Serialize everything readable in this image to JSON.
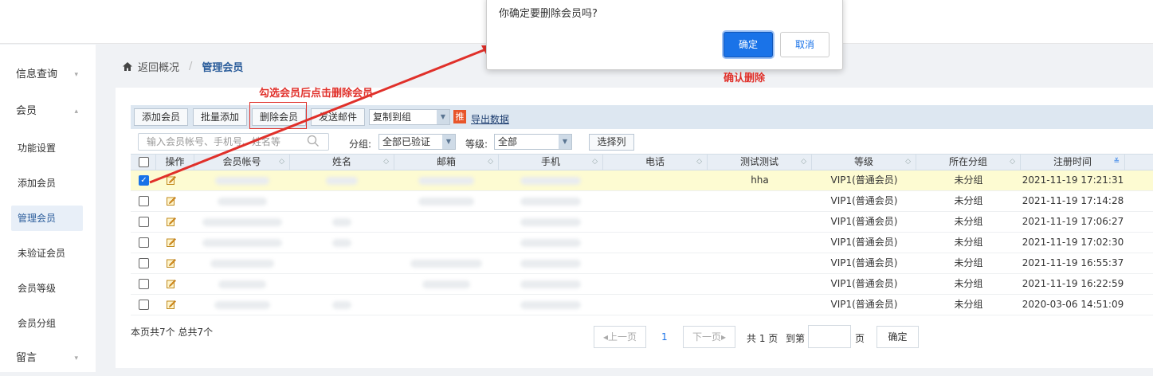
{
  "sidebar": {
    "items": [
      {
        "label": "信息查询",
        "arrow": "▾"
      },
      {
        "label": "会员",
        "arrow": "▴"
      },
      {
        "label": "功能设置"
      },
      {
        "label": "添加会员"
      },
      {
        "label": "管理会员"
      },
      {
        "label": "未验证会员"
      },
      {
        "label": "会员等级"
      },
      {
        "label": "会员分组"
      },
      {
        "label": "留言",
        "arrow": "▾"
      }
    ]
  },
  "breadcrumb": {
    "back": "返回概况",
    "sep": "/",
    "current": "管理会员"
  },
  "toolbar": {
    "add": "添加会员",
    "batch_add": "批量添加",
    "delete": "删除会员",
    "send_mail": "发送邮件",
    "copy_to_group": "复制到组",
    "tui_badge": "推",
    "export": "导出数据"
  },
  "filters": {
    "search_placeholder": "输入会员帐号、手机号、姓名等",
    "group_label": "分组:",
    "group_value": "全部已验证",
    "level_label": "等级:",
    "level_value": "全部",
    "choose_cols": "选择列"
  },
  "table": {
    "headers": [
      "操作",
      "会员帐号",
      "姓名",
      "邮箱",
      "手机",
      "电话",
      "测试测试",
      "等级",
      "所在分组",
      "注册时间"
    ],
    "rows": [
      {
        "checked": true,
        "test": "hha",
        "level": "VIP1(普通会员)",
        "group": "未分组",
        "time": "2021-11-19 17:21:31"
      },
      {
        "checked": false,
        "test": "",
        "level": "VIP1(普通会员)",
        "group": "未分组",
        "time": "2021-11-19 17:14:28"
      },
      {
        "checked": false,
        "test": "",
        "level": "VIP1(普通会员)",
        "group": "未分组",
        "time": "2021-11-19 17:06:27"
      },
      {
        "checked": false,
        "test": "",
        "level": "VIP1(普通会员)",
        "group": "未分组",
        "time": "2021-11-19 17:02:30"
      },
      {
        "checked": false,
        "test": "",
        "level": "VIP1(普通会员)",
        "group": "未分组",
        "time": "2021-11-19 16:55:37"
      },
      {
        "checked": false,
        "test": "",
        "level": "VIP1(普通会员)",
        "group": "未分组",
        "time": "2021-11-19 16:22:59"
      },
      {
        "checked": false,
        "test": "",
        "level": "VIP1(普通会员)",
        "group": "未分组",
        "time": "2020-03-06 14:51:09"
      }
    ]
  },
  "pager": {
    "info": "本页共7个 总共7个",
    "prev": "上一页",
    "page": "1",
    "next": "下一页",
    "total": "共 1 页",
    "goto": "到第",
    "page_unit": "页",
    "confirm": "确定"
  },
  "dialog": {
    "message": "你确定要删除会员吗?",
    "ok": "确定",
    "cancel": "取消"
  },
  "annotations": {
    "select_then_delete": "勾选会员后点击删除会员",
    "confirm_delete": "确认删除"
  },
  "colors": {
    "accent": "#1a73e8",
    "annotation": "#e0302a",
    "selected_row": "#fdfbd2",
    "header_bg": "#e8eef5"
  }
}
